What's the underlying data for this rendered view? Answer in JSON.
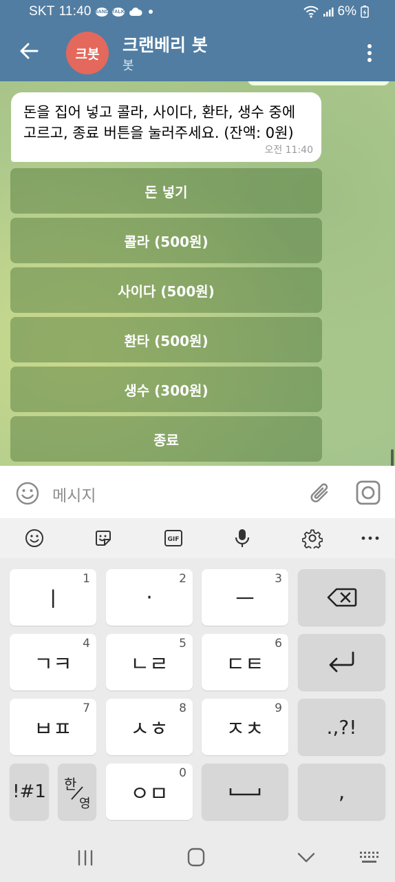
{
  "status_bar": {
    "carrier": "SKT",
    "time": "11:40",
    "badge1": "BAND",
    "badge2": "TALK",
    "battery": "6%"
  },
  "header": {
    "avatar_text": "크봇",
    "title": "크랜베리 봇",
    "subtitle": "봇"
  },
  "message": {
    "text": "돈을 집어 넣고 콜라, 사이다, 환타, 생수 중에 고르고, 종료 버튼을 눌러주세요. (잔액: 0원)",
    "time": "오전 11:40"
  },
  "inline_buttons": [
    {
      "label": "돈 넣기"
    },
    {
      "label": "콜라 (500원)"
    },
    {
      "label": "사이다 (500원)"
    },
    {
      "label": "환타 (500원)"
    },
    {
      "label": "생수 (300원)"
    },
    {
      "label": "종료"
    }
  ],
  "input": {
    "placeholder": "메시지"
  },
  "keyboard": {
    "toolbar": {
      "gif": "GIF"
    },
    "rows": [
      [
        {
          "char": "ㅣ",
          "num": "1"
        },
        {
          "char": "·",
          "num": "2"
        },
        {
          "char": "ㅡ",
          "num": "3"
        }
      ],
      [
        {
          "char": "ㄱㅋ",
          "num": "4"
        },
        {
          "char": "ㄴㄹ",
          "num": "5"
        },
        {
          "char": "ㄷㅌ",
          "num": "6"
        }
      ],
      [
        {
          "char": "ㅂㅍ",
          "num": "7"
        },
        {
          "char": "ㅅㅎ",
          "num": "8"
        },
        {
          "char": "ㅈㅊ",
          "num": "9"
        }
      ]
    ],
    "punct": ".,?!",
    "symbols": "!#1",
    "lang_top": "한",
    "lang_bottom": "영",
    "bottom_center": {
      "char": "ㅇㅁ",
      "num": "0"
    },
    "comma": ","
  }
}
